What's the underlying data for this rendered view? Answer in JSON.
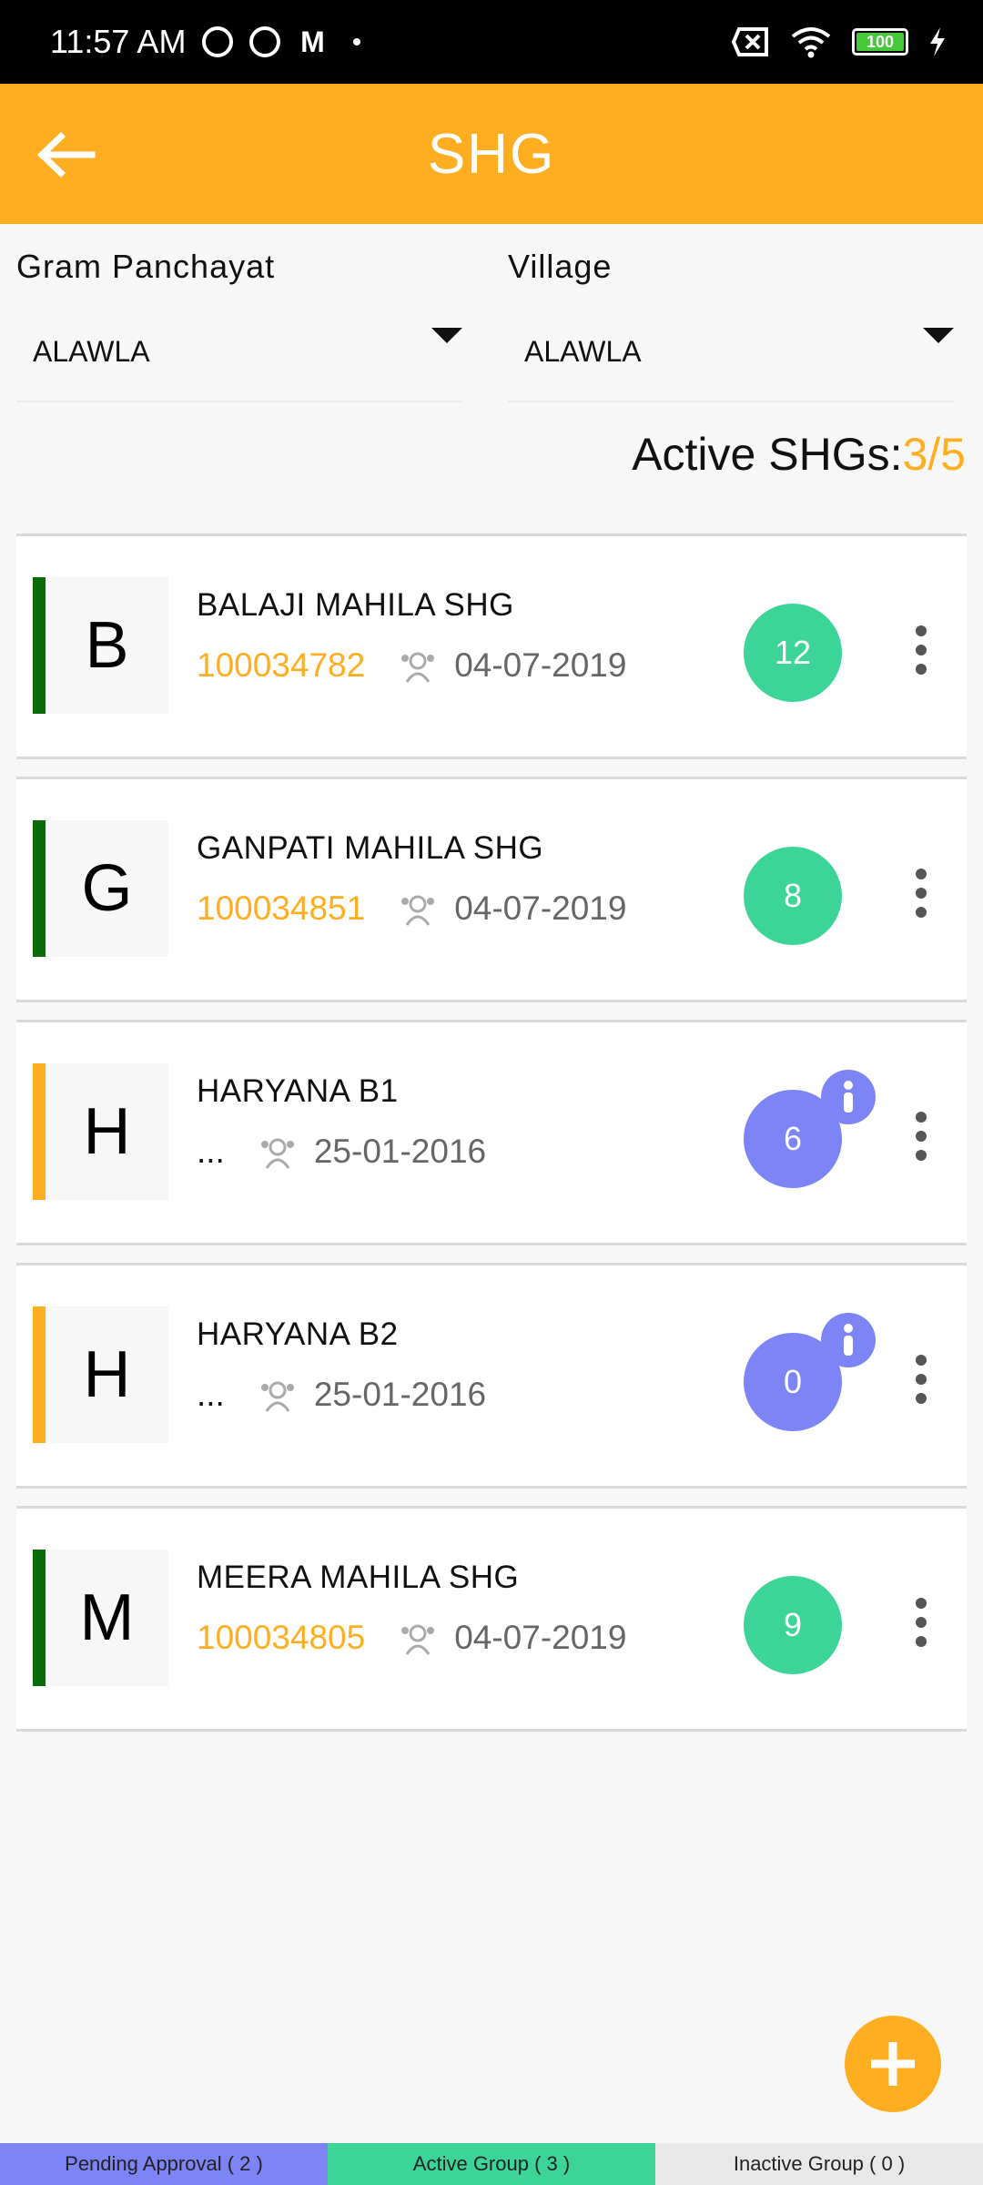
{
  "status_bar": {
    "time": "11:57 AM",
    "battery": "100",
    "icons": [
      "notification-icon",
      "sync-icon",
      "gmail-icon",
      "dot-icon",
      "no-sim-icon",
      "wifi-icon",
      "battery-icon",
      "charging-icon"
    ]
  },
  "header": {
    "title": "SHG",
    "back_icon": "arrow-left-icon"
  },
  "filters": {
    "gram_panchayat": {
      "label": "Gram Panchayat",
      "value": "ALAWLA"
    },
    "village": {
      "label": "Village",
      "value": "ALAWLA"
    }
  },
  "active_shgs": {
    "label": "Active SHGs:",
    "value": "3/5"
  },
  "colors": {
    "primary": "#ffae22",
    "active_bar": "#0a6b0a",
    "pending_bar": "#ffae22",
    "active_badge": "#3dd597",
    "pending_badge": "#7d84f5",
    "tab_pending": "#7d84f5",
    "tab_active": "#3dd597",
    "tab_inactive": "#e8e8e8"
  },
  "shgs": [
    {
      "initial": "B",
      "name": "BALAJI MAHILA SHG",
      "code": "100034782",
      "date": "04-07-2019",
      "members": "12",
      "status": "active"
    },
    {
      "initial": "G",
      "name": "GANPATI MAHILA SHG",
      "code": "100034851",
      "date": "04-07-2019",
      "members": "8",
      "status": "active"
    },
    {
      "initial": "H",
      "name": "HARYANA B1",
      "code": "...",
      "date": "25-01-2016",
      "members": "6",
      "status": "pending"
    },
    {
      "initial": "H",
      "name": "HARYANA B2",
      "code": "...",
      "date": "25-01-2016",
      "members": "0",
      "status": "pending"
    },
    {
      "initial": "M",
      "name": "MEERA MAHILA SHG",
      "code": "100034805",
      "date": "04-07-2019",
      "members": "9",
      "status": "active"
    }
  ],
  "bottom_tabs": [
    {
      "label": "Pending Approval ( 2 )"
    },
    {
      "label": "Active Group ( 3 )"
    },
    {
      "label": "Inactive Group ( 0 )"
    }
  ]
}
